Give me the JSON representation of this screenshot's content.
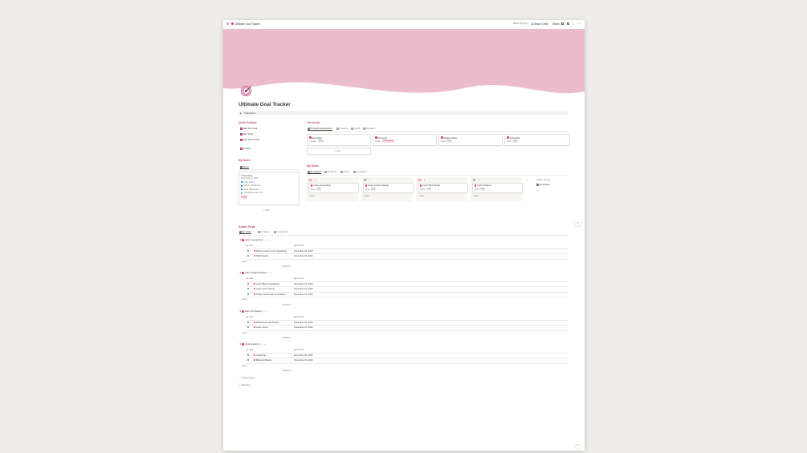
{
  "topbar": {
    "page_title": "Ultimate Goal Tracker",
    "edited": "Edited 18m ago",
    "share": "Share Credit",
    "share_btn": "Share"
  },
  "page": {
    "title": "Ultimate Goal Tracker",
    "instructions": "Instructions"
  },
  "quick_actions": {
    "heading": "Quick Actions",
    "items": [
      "New Life Area",
      "New Goal",
      "New Action Step",
      "Archive"
    ]
  },
  "my_notes": {
    "heading": "My Notes",
    "tab": "Notes",
    "card_title": "My Notes",
    "card_sub": "November 6, 2023",
    "checks": [
      {
        "label": "Daily goal 1",
        "checked": true
      },
      {
        "label": "Monthly Reflection",
        "checked": true
      },
      {
        "label": "Goal Milestones",
        "checked": true
      },
      {
        "label": "Celebrate small wins",
        "checked": false
      }
    ],
    "status": "Done",
    "new": "+ New"
  },
  "life_areas": {
    "heading": "Life Areas",
    "tabs": [
      "Personal Development",
      "Finances",
      "Health",
      "Education"
    ],
    "cards": [
      {
        "title": "Education",
        "meta": "3 Goals",
        "badge": "Low"
      },
      {
        "title": "Personal",
        "meta": "Active",
        "badge": "In Progress"
      },
      {
        "title": "Relationships",
        "meta": "Goal",
        "badge": "Low"
      },
      {
        "title": "Spirituality",
        "meta": "Goal",
        "badge": "Low"
      }
    ],
    "new": "+ New"
  },
  "my_goals": {
    "heading": "My Goals",
    "tabs": [
      "By Quarter",
      "By Month",
      "Active",
      "By Quarter"
    ],
    "columns": [
      {
        "head": "Q1",
        "count": "1",
        "card": "Learn Copywriting",
        "meta": "Done",
        "badge": "Low"
      },
      {
        "head": "Q2",
        "count": "1",
        "card": "Learn Graphic Design",
        "meta": "Done",
        "badge": "Low"
      },
      {
        "head": "Q3",
        "count": "1",
        "card": "Learn Web Design",
        "meta": "Active",
        "badge": "Low"
      },
      {
        "head": "Q4",
        "count": "1",
        "card": "Code Academy",
        "meta": "Done",
        "badge": "Low"
      }
    ],
    "hidden_head": "Hidden groups",
    "hidden_item": "No Quarter",
    "new": "+ New"
  },
  "action_steps": {
    "heading": "Action Steps",
    "tabs": [
      "By Goals",
      "By Status",
      "Completed"
    ],
    "col_task": "Task",
    "col_date": "Do Date",
    "new": "+ New",
    "calc": "COUNT 3",
    "groups": [
      {
        "name": "Learn Copywriting",
        "count": "2",
        "rows": [
          {
            "task": "Define Content and Copywriting",
            "date": "November 16, 2023"
          },
          {
            "task": "SEO Course",
            "date": "November 23, 2023"
          }
        ]
      },
      {
        "name": "Learn Graphic Design",
        "count": "3",
        "rows": [
          {
            "task": "Learn Basic Typography",
            "date": "December 19, 2023"
          },
          {
            "task": "Learn Color Theory",
            "date": "November 21, 2023"
          },
          {
            "task": "Study Layout and Composition",
            "date": "November 16, 2023"
          }
        ]
      },
      {
        "name": "Learn UX Design",
        "count": "2",
        "rows": [
          {
            "task": "Wireframes with Figma",
            "date": "November 16, 2023"
          },
          {
            "task": "Learn Action",
            "date": "November 16, 2023"
          }
        ]
      },
      {
        "name": "Code Academy",
        "count": "2",
        "rows": [
          {
            "task": "JavaScript",
            "date": "December 29, 2023"
          },
          {
            "task": "Backend Basics",
            "date": "November 29, 2023"
          }
        ]
      }
    ],
    "hidden": "1 hidden group",
    "add_group": "+ Add group"
  },
  "colors": {
    "cover": "#ebbccc",
    "accent": "#c0437f",
    "blue": "#2383e2"
  }
}
